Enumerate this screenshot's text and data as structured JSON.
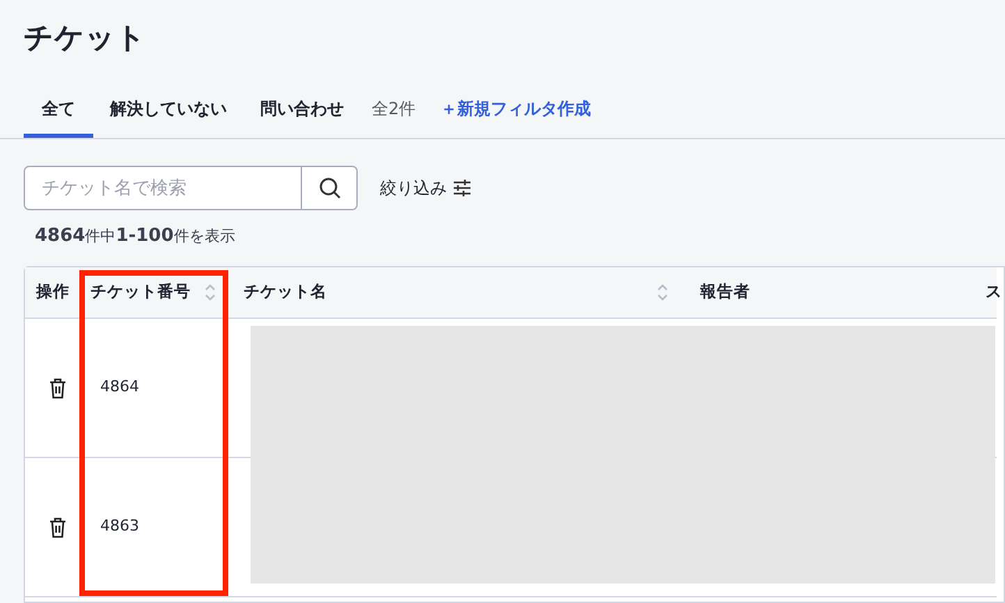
{
  "page_title": "チケット",
  "tabs": [
    {
      "label": "全て",
      "selected": true
    },
    {
      "label": "解決していない",
      "selected": false
    },
    {
      "label": "問い合わせ",
      "selected": false
    }
  ],
  "tab_count": "全2件",
  "new_filter_link": "＋新規フィルタ作成",
  "search": {
    "placeholder": "チケット名で検索"
  },
  "filter_button": "絞り込み",
  "result_summary": "**4864**件中**1-100**件を表示",
  "table": {
    "columns": [
      {
        "label": "操作",
        "sortable": false,
        "highlighted": false
      },
      {
        "label": "チケット番号",
        "sortable": true,
        "highlighted": true
      },
      {
        "label": "チケット名",
        "sortable": true,
        "highlighted": false
      },
      {
        "label": "報告者",
        "sortable": false,
        "highlighted": false
      },
      {
        "label": "ス",
        "sortable": false,
        "highlighted": false
      }
    ],
    "rows": [
      {
        "ticket_number": "4864"
      },
      {
        "ticket_number": "4863"
      }
    ],
    "redacted": true
  }
}
